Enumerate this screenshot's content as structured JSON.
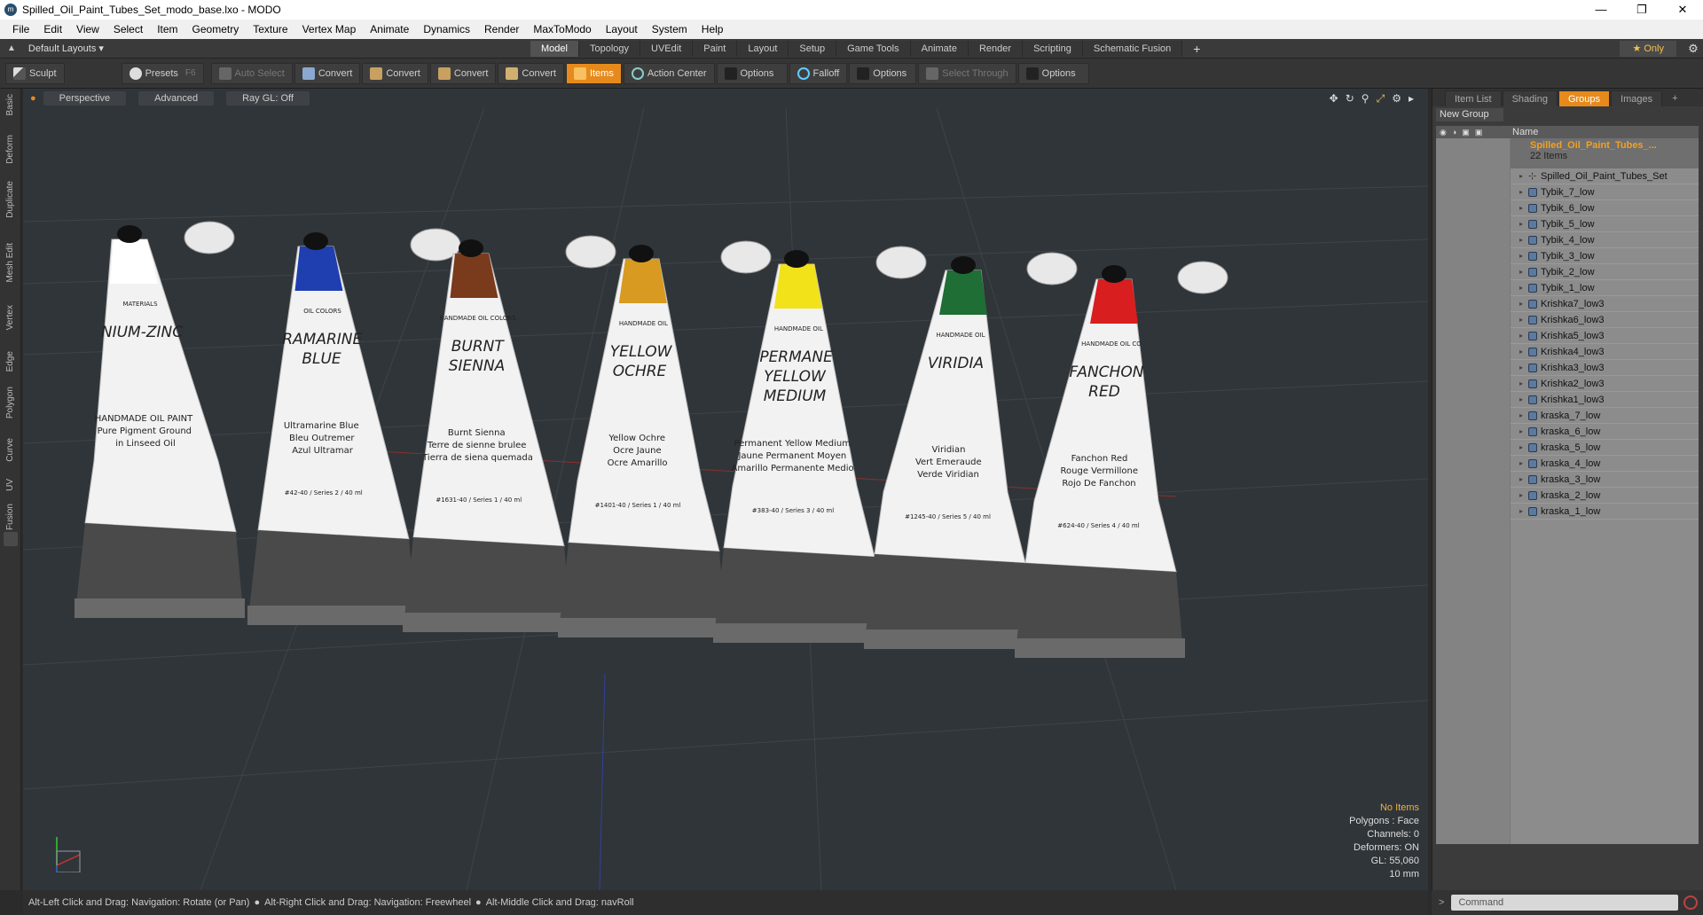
{
  "window": {
    "title": "Spilled_Oil_Paint_Tubes_Set_modo_base.lxo - MODO"
  },
  "menu": [
    "File",
    "Edit",
    "View",
    "Select",
    "Item",
    "Geometry",
    "Texture",
    "Vertex Map",
    "Animate",
    "Dynamics",
    "Render",
    "MaxToModo",
    "Layout",
    "System",
    "Help"
  ],
  "layout": {
    "label": "Default Layouts"
  },
  "tabs": [
    "Model",
    "Topology",
    "UVEdit",
    "Paint",
    "Layout",
    "Setup",
    "Game Tools",
    "Animate",
    "Render",
    "Scripting",
    "Schematic Fusion"
  ],
  "active_tab": "Model",
  "only_label": "Only",
  "toolbar": {
    "sculpt": "Sculpt",
    "presets": "Presets",
    "presets_key": "F6",
    "auto_select": "Auto Select",
    "convert1": "Convert",
    "convert2": "Convert",
    "convert3": "Convert",
    "convert4": "Convert",
    "items": "Items",
    "action_center": "Action Center",
    "options1": "Options",
    "falloff": "Falloff",
    "options2": "Options",
    "select_through": "Select Through",
    "options3": "Options"
  },
  "left_tabs": [
    "Basic",
    "Deform",
    "Duplicate",
    "Mesh Edit",
    "Vertex",
    "Edge",
    "Polygon",
    "Curve",
    "UV",
    "Fusion"
  ],
  "viewport": {
    "view": "Perspective",
    "shading": "Advanced",
    "raygl": "Ray GL: Off",
    "stats": {
      "selection": "No Items",
      "polygons": "Polygons : Face",
      "channels": "Channels: 0",
      "deformers": "Deformers: ON",
      "gl": "GL: 55,060",
      "scale": "10 mm"
    }
  },
  "tubes": [
    {
      "cap": "#ffffff",
      "label1": "NIUM-ZINC",
      "label2": "",
      "small1": "MATERIALS",
      "small2": "HANDMADE OIL PAINT",
      "small3": "Pure Pigment Ground",
      "small4": "in Linseed Oil",
      "series": ""
    },
    {
      "cap": "#1f3fb0",
      "label1": "RAMARINE",
      "label2": "BLUE",
      "small1": "OIL COLORS",
      "small2": "Ultramarine Blue",
      "small3": "Bleu Outremer",
      "small4": "Azul Ultramar",
      "series": "#42-40 / Series 2 / 40 ml"
    },
    {
      "cap": "#7a3a1c",
      "label1": "BURNT",
      "label2": "SIENNA",
      "small1": "HANDMADE OIL COLORS",
      "small2": "Burnt Sienna",
      "small3": "Terre de sienne brulee",
      "small4": "Tierra de siena quemada",
      "series": "#1631-40 / Series 1 / 40 ml"
    },
    {
      "cap": "#d89a20",
      "label1": "YELLOW",
      "label2": "OCHRE",
      "small1": "HANDMADE OIL",
      "small2": "Yellow Ochre",
      "small3": "Ocre Jaune",
      "small4": "Ocre Amarillo",
      "series": "#1401-40 / Series 1 / 40 ml"
    },
    {
      "cap": "#f2e21a",
      "label1": "PERMANE",
      "label2": "YELLOW",
      "label3": "MEDIUM",
      "small1": "HANDMADE OIL",
      "small2": "Permanent Yellow Medium",
      "small3": "Jaune Permanent Moyen",
      "small4": "Amarillo Permanente Medio",
      "series": "#383-40 / Series 3 / 40 ml"
    },
    {
      "cap": "#1e6e35",
      "label1": "VIRIDIA",
      "label2": "",
      "small1": "HANDMADE OIL",
      "small2": "Viridian",
      "small3": "Vert Emeraude",
      "small4": "Verde Viridian",
      "series": "#1245-40 / Series 5 / 40 ml"
    },
    {
      "cap": "#d81e1e",
      "label1": "FANCHON",
      "label2": "RED",
      "small1": "HANDMADE OIL CO",
      "small2": "Fanchon Red",
      "small3": "Rouge Vermillone",
      "small4": "Rojo De Fanchon",
      "series": "#624-40 / Series 4 / 40 ml"
    }
  ],
  "panel": {
    "tabs": [
      "Item List",
      "Shading",
      "Groups",
      "Images"
    ],
    "active_tab": "Groups",
    "new_group": "New Group",
    "column_name": "Name",
    "group_name": "Spilled_Oil_Paint_Tubes_...",
    "group_count": "22 Items",
    "items": [
      {
        "name": "Spilled_Oil_Paint_Tubes_Set",
        "type": "locator"
      },
      {
        "name": "Tybik_7_low",
        "type": "mesh"
      },
      {
        "name": "Tybik_6_low",
        "type": "mesh"
      },
      {
        "name": "Tybik_5_low",
        "type": "mesh"
      },
      {
        "name": "Tybik_4_low",
        "type": "mesh"
      },
      {
        "name": "Tybik_3_low",
        "type": "mesh"
      },
      {
        "name": "Tybik_2_low",
        "type": "mesh"
      },
      {
        "name": "Tybik_1_low",
        "type": "mesh"
      },
      {
        "name": "Krishka7_low3",
        "type": "mesh"
      },
      {
        "name": "Krishka6_low3",
        "type": "mesh"
      },
      {
        "name": "Krishka5_low3",
        "type": "mesh"
      },
      {
        "name": "Krishka4_low3",
        "type": "mesh"
      },
      {
        "name": "Krishka3_low3",
        "type": "mesh"
      },
      {
        "name": "Krishka2_low3",
        "type": "mesh"
      },
      {
        "name": "Krishka1_low3",
        "type": "mesh"
      },
      {
        "name": "kraska_7_low",
        "type": "mesh"
      },
      {
        "name": "kraska_6_low",
        "type": "mesh"
      },
      {
        "name": "kraska_5_low",
        "type": "mesh"
      },
      {
        "name": "kraska_4_low",
        "type": "mesh"
      },
      {
        "name": "kraska_3_low",
        "type": "mesh"
      },
      {
        "name": "kraska_2_low",
        "type": "mesh"
      },
      {
        "name": "kraska_1_low",
        "type": "mesh"
      }
    ]
  },
  "status": {
    "hint1": "Alt-Left Click and Drag: Navigation: Rotate (or Pan)",
    "hint2": "Alt-Right Click and Drag: Navigation: Freewheel",
    "hint3": "Alt-Middle Click and Drag: navRoll"
  },
  "command": {
    "placeholder": "Command"
  }
}
